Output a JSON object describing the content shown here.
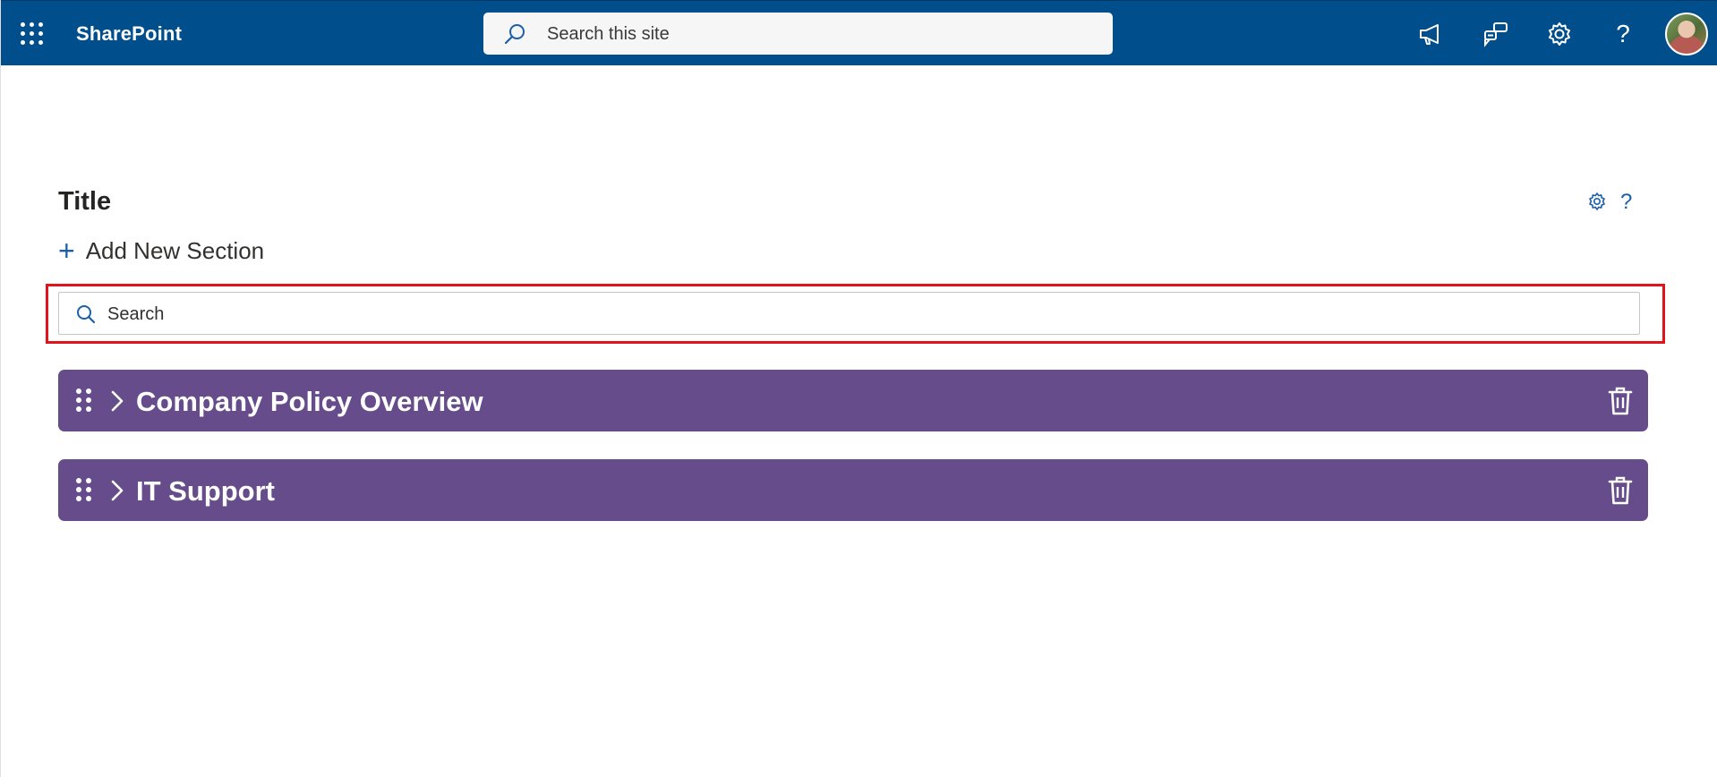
{
  "suite_bar": {
    "app_name": "SharePoint",
    "search_placeholder": "Search this site",
    "icons": [
      "app-launcher-icon",
      "megaphone-icon",
      "feedback-icon",
      "gear-icon",
      "help-icon"
    ],
    "help_glyph": "?",
    "background_color": "#004e8c"
  },
  "webpart": {
    "title": "Title",
    "add_section_plus": "+",
    "add_section_label": "Add New Section",
    "help_glyph": "?",
    "search_placeholder": "Search",
    "highlight_color": "#e3131c",
    "sections": [
      {
        "title": "Company Policy Overview",
        "expanded": false
      },
      {
        "title": "IT Support",
        "expanded": false
      }
    ],
    "section_color": "#674c8c"
  }
}
